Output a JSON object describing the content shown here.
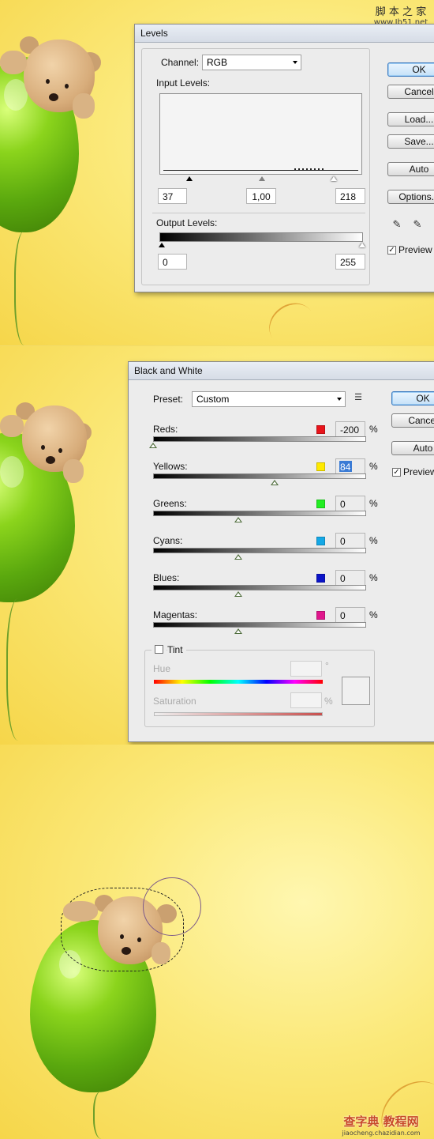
{
  "watermark_top": {
    "chars": "脚 本 之 家",
    "url": "www.Jb51.net"
  },
  "levels": {
    "title": "Levels",
    "channel_label": "Channel:",
    "channel_value": "RGB",
    "input_levels_label": "Input Levels:",
    "input_values": [
      "37",
      "1,00",
      "218"
    ],
    "output_levels_label": "Output Levels:",
    "output_values": [
      "0",
      "255"
    ],
    "buttons": {
      "ok": "OK",
      "cancel": "Cancel",
      "load": "Load...",
      "save": "Save...",
      "auto": "Auto",
      "options": "Options..."
    },
    "preview_label": "Preview",
    "preview_checked": true
  },
  "bw": {
    "title": "Black and White",
    "preset_label": "Preset:",
    "preset_value": "Custom",
    "sliders": [
      {
        "label": "Reds:",
        "value": "-200",
        "color": "#e8141b",
        "position": 0.0
      },
      {
        "label": "Yellows:",
        "value": "84",
        "color": "#ffea00",
        "position": 0.57
      },
      {
        "label": "Greens:",
        "value": "0",
        "color": "#22ee22",
        "position": 0.4
      },
      {
        "label": "Cyans:",
        "value": "0",
        "color": "#14a8e6",
        "position": 0.4
      },
      {
        "label": "Blues:",
        "value": "0",
        "color": "#0b14c8",
        "position": 0.4
      },
      {
        "label": "Magentas:",
        "value": "0",
        "color": "#e0168c",
        "position": 0.4
      }
    ],
    "percent": "%",
    "tint_label": "Tint",
    "hue_label": "Hue",
    "degree": "°",
    "saturation_label": "Saturation",
    "buttons": {
      "ok": "OK",
      "cancel": "Cancel",
      "auto": "Auto"
    },
    "preview_label": "Preview",
    "preview_checked": true
  },
  "watermark_bottom": {
    "chars": "查字典 教程网",
    "url": "jiaocheng.chazidian.com"
  }
}
